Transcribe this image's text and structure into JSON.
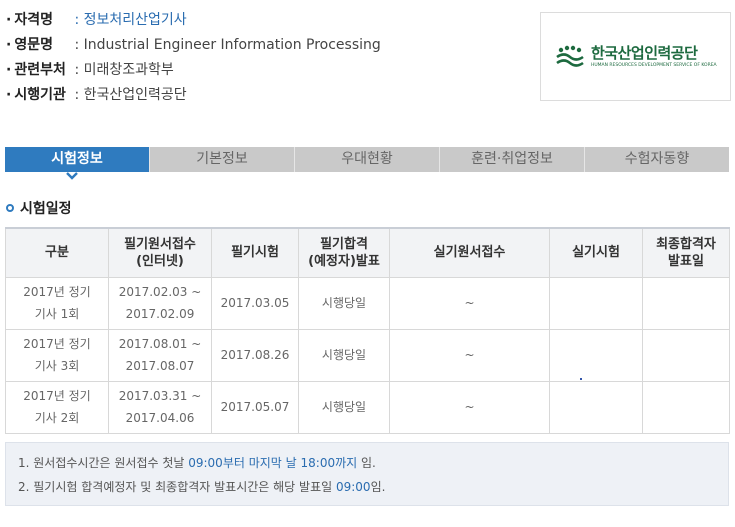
{
  "info": {
    "rows": [
      {
        "label": "자격명",
        "value": ": 정보처리산업기사"
      },
      {
        "label": "영문명",
        "value": ": Industrial Engineer Information Processing"
      },
      {
        "label": "관련부처",
        "value": ": 미래창조과학부"
      },
      {
        "label": "시행기관",
        "value": ": 한국산업인력공단"
      }
    ]
  },
  "logo": {
    "name": "한국산업인력공단",
    "sub": "HUMAN RESOURCES DEVELOPMENT SERVICE OF KOREA",
    "color": "#1d6a3f"
  },
  "tabs": [
    "시험정보",
    "기본정보",
    "우대현황",
    "훈련·취업정보",
    "수험자동향"
  ],
  "section": {
    "title": "시험일정"
  },
  "table": {
    "headers": [
      [
        "구분",
        ""
      ],
      [
        "필기원서접수",
        "(인터넷)"
      ],
      [
        "필기시험",
        ""
      ],
      [
        "필기합격",
        "(예정자)발표"
      ],
      [
        "실기원서접수",
        ""
      ],
      [
        "실기시험",
        ""
      ],
      [
        "최종합격자",
        "발표일"
      ]
    ],
    "rows": [
      {
        "type": [
          "2017년 정기",
          "기사 1회"
        ],
        "apply": [
          "2017.02.03 ~",
          "2017.02.09"
        ],
        "exam": "2017.03.05",
        "pass": "시행당일",
        "prac_apply": "~",
        "prac_exam": "",
        "final": ""
      },
      {
        "type": [
          "2017년 정기",
          "기사 3회"
        ],
        "apply": [
          "2017.08.01 ~",
          "2017.08.07"
        ],
        "exam": "2017.08.26",
        "pass": "시행당일",
        "prac_apply": "~",
        "prac_exam": "",
        "final": ""
      },
      {
        "type": [
          "2017년 정기",
          "기사 2회"
        ],
        "apply": [
          "2017.03.31 ~",
          "2017.04.06"
        ],
        "exam": "2017.05.07",
        "pass": "시행당일",
        "prac_apply": "~",
        "prac_exam": "",
        "final": ""
      }
    ]
  },
  "notes": {
    "n1_pre": "1. 원서접수시간은 원서접수 첫날 ",
    "n1_hl": "09:00부터 마지막 날 18:00까지",
    "n1_post": " 임.",
    "n2_pre": "2. 필기시험 합격예정자 및 최종합격자 발표시간은 해당 발표일 ",
    "n2_hl": "09:00",
    "n2_post": "임."
  }
}
